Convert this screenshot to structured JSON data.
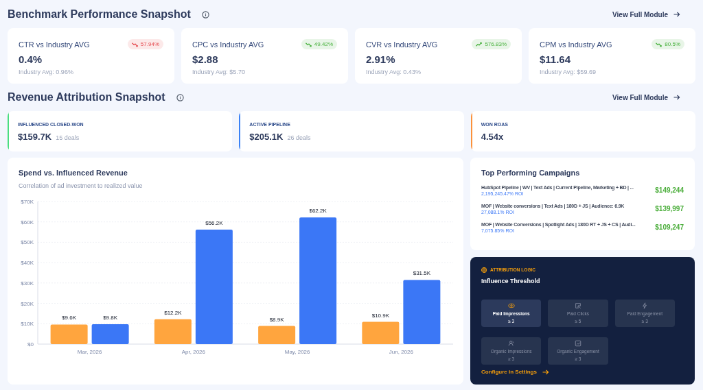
{
  "benchmark": {
    "title": "Benchmark Performance Snapshot",
    "link": "View Full Module",
    "cards": [
      {
        "label": "CTR vs Industry AVG",
        "value": "0.4%",
        "industry": "Industry Avg: 0.96%",
        "change": "57.94%",
        "kind": "down",
        "color": "#e5484d"
      },
      {
        "label": "CPC vs Industry AVG",
        "value": "$2.88",
        "industry": "Industry Avg: $5.70",
        "change": "49.42%",
        "kind": "down",
        "color": "#45b03a"
      },
      {
        "label": "CVR vs Industry AVG",
        "value": "2.91%",
        "industry": "Industry Avg: 0.43%",
        "change": "576.83%",
        "kind": "up",
        "color": "#45b03a"
      },
      {
        "label": "CPM vs Industry AVG",
        "value": "$11.64",
        "industry": "Industry Avg: $59.69",
        "change": "80.5%",
        "kind": "down",
        "color": "#45b03a"
      }
    ]
  },
  "revenue": {
    "title": "Revenue Attribution Snapshot",
    "link": "View Full Module",
    "stats": [
      {
        "label": "INFLUENCED CLOSED-WON",
        "value": "$159.7K",
        "note": "15 deals",
        "color": "#4ade80"
      },
      {
        "label": "ACTIVE PIPELINE",
        "value": "$205.1K",
        "note": "26 deals",
        "color": "#3b82f6"
      },
      {
        "label": "WON ROAS",
        "value": "4.54x",
        "color": "#fb923c"
      }
    ]
  },
  "spend_chart": {
    "title": "Spend vs. Influenced Revenue",
    "subtitle": "Correlation of ad investment to realized value",
    "chart_data": {
      "type": "bar",
      "categories": [
        "Mar, 2026",
        "Apr, 2026",
        "May, 2026",
        "Jun, 2026"
      ],
      "series": [
        {
          "color": "#ffa53e",
          "values": [
            9600,
            12200,
            8900,
            10900
          ],
          "value_labels": [
            "$9.6K",
            "$12.2K",
            "$8.9K",
            "$10.9K"
          ]
        },
        {
          "color": "#3b77f6",
          "values": [
            9800,
            56200,
            62200,
            31500
          ],
          "value_labels": [
            "$9.8K",
            "$56.2K",
            "$62.2K",
            "$31.5K"
          ]
        }
      ],
      "ylim": [
        0,
        70000
      ],
      "yticks": [
        {
          "value": 0,
          "label": "$0"
        },
        {
          "value": 10000,
          "label": "$10K"
        },
        {
          "value": 20000,
          "label": "$20K"
        },
        {
          "value": 30000,
          "label": "$30K"
        },
        {
          "value": 40000,
          "label": "$40K"
        },
        {
          "value": 50000,
          "label": "$50K"
        },
        {
          "value": 60000,
          "label": "$60K"
        },
        {
          "value": 70000,
          "label": "$70K"
        }
      ],
      "grid": true,
      "data_labels": true
    }
  },
  "top_campaigns": {
    "title": "Top Performing Campaigns",
    "items": [
      {
        "name": "HubSpot Pipeline | WV | Text Ads | Current Pipeline, Marketing + BD | ...",
        "roi": "2,195,245.47% ROI",
        "revenue": "$149,244"
      },
      {
        "name": "MOF | Website conversions | Text Ads | 180D + JS | Audience: 6.9K",
        "roi": "27,088.1% ROI",
        "revenue": "$139,997"
      },
      {
        "name": "MOF | Website Conversions | Spotlight Ads | 180D RT + JS + CS | Audi...",
        "roi": "7,075.85% ROI",
        "revenue": "$109,247"
      }
    ]
  },
  "attribution": {
    "eyebrow": "ATTRIBUTION LOGIC",
    "title": "Influence Threshold",
    "thresholds": [
      {
        "label": "Paid Impressions",
        "value": "≥ 3",
        "active": true
      },
      {
        "label": "Paid Clicks",
        "value": "≥ 5",
        "active": false
      },
      {
        "label": "Paid Engagement",
        "value": "≥ 3",
        "active": false
      },
      {
        "label": "Organic Impressions",
        "value": "≥ 3",
        "active": false
      },
      {
        "label": "Organic Engagement",
        "value": "≥ 3",
        "active": false
      }
    ],
    "link": "Configure in Settings"
  }
}
